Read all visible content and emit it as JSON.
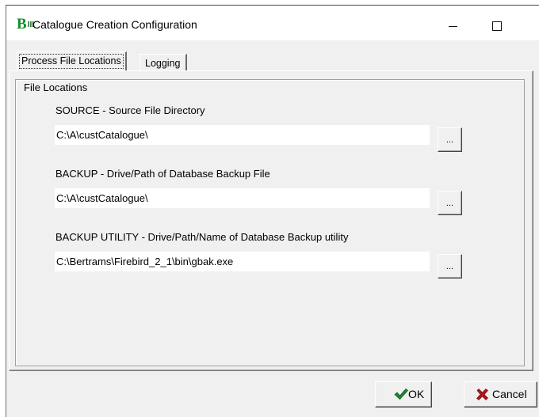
{
  "window": {
    "title": "Catalogue Creation Configuration",
    "icon_text": "B",
    "icon_small_text": "III"
  },
  "tabs": [
    {
      "label": "Process File Locations",
      "active": true
    },
    {
      "label": "Logging",
      "active": false
    }
  ],
  "group": {
    "title": "File Locations"
  },
  "fields": [
    {
      "label": "SOURCE - Source File Directory",
      "value": "C:\\A\\custCatalogue\\",
      "browse_label": "..."
    },
    {
      "label": "BACKUP - Drive/Path of Database Backup File",
      "value": "C:\\A\\custCatalogue\\",
      "browse_label": "..."
    },
    {
      "label": "BACKUP UTILITY - Drive/Path/Name of Database Backup utility",
      "value": "C:\\Bertrams\\Firebird_2_1\\bin\\gbak.exe",
      "browse_label": "..."
    }
  ],
  "buttons": {
    "ok_label": "OK",
    "cancel_label": "Cancel"
  },
  "colors": {
    "check_green": "#1e8a2e",
    "cancel_red": "#b0141a",
    "icon_green": "#0a8f2a"
  }
}
